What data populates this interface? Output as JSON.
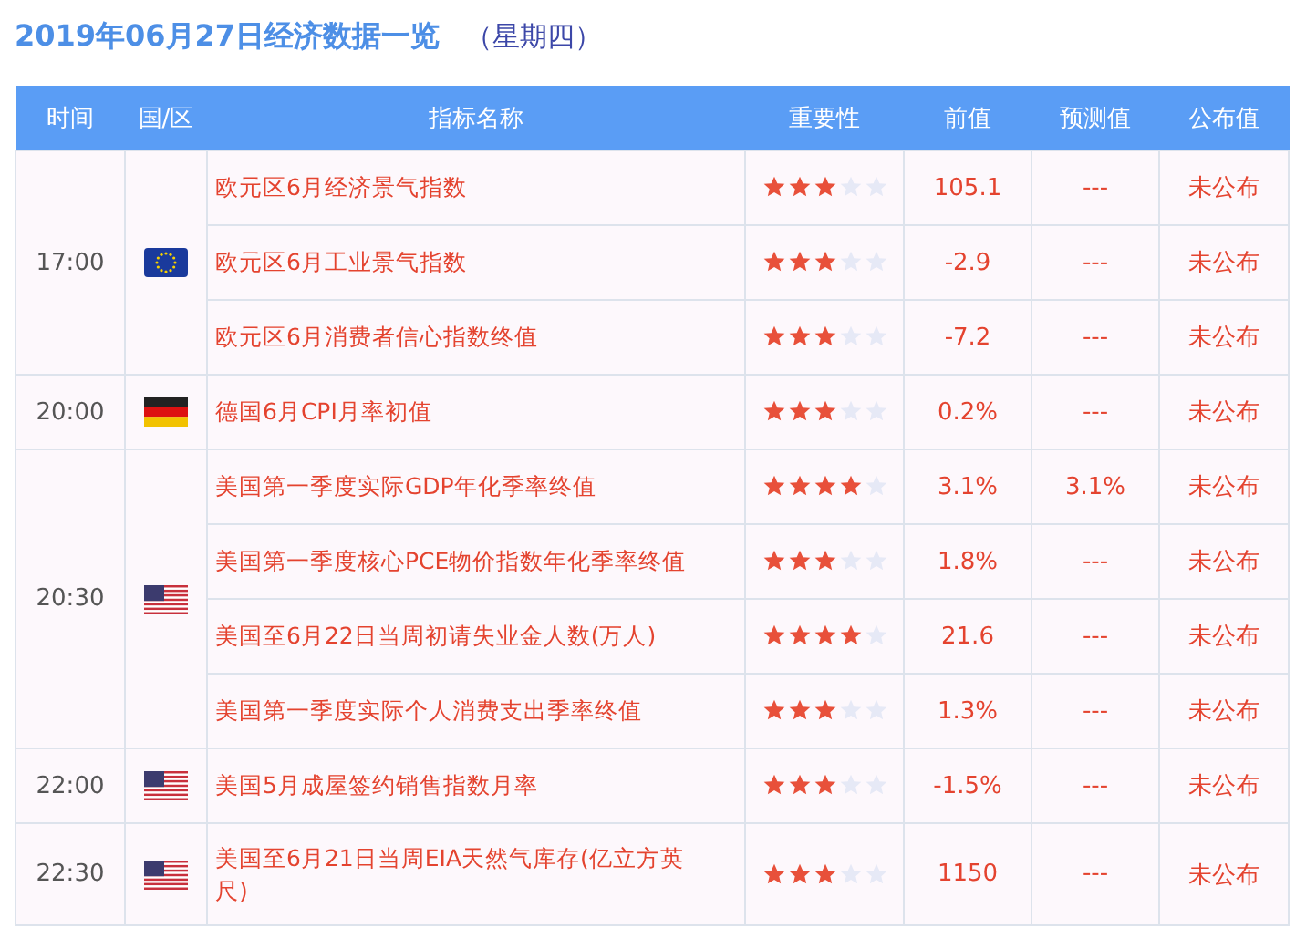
{
  "title": {
    "date": "2019年06月27日经济数据一览",
    "weekday": "（星期四）"
  },
  "columns": [
    "时间",
    "国/区",
    "指标名称",
    "重要性",
    "前值",
    "预测值",
    "公布值"
  ],
  "groups": [
    {
      "time": "17:00",
      "kind": "eu",
      "events": [
        {
          "name": "欧元区6月经济景气指数",
          "stars": 3,
          "previous": "105.1",
          "forecast": "---",
          "actual": "未公布"
        },
        {
          "name": "欧元区6月工业景气指数",
          "stars": 3,
          "previous": "-2.9",
          "forecast": "---",
          "actual": "未公布"
        },
        {
          "name": "欧元区6月消费者信心指数终值",
          "stars": 3,
          "previous": "-7.2",
          "forecast": "---",
          "actual": "未公布"
        }
      ]
    },
    {
      "time": "20:00",
      "kind": "de",
      "events": [
        {
          "name": "德国6月CPI月率初值",
          "stars": 3,
          "previous": "0.2%",
          "forecast": "---",
          "actual": "未公布"
        }
      ]
    },
    {
      "time": "20:30",
      "kind": "us",
      "events": [
        {
          "name": "美国第一季度实际GDP年化季率终值",
          "stars": 4,
          "previous": "3.1%",
          "forecast": "3.1%",
          "actual": "未公布"
        },
        {
          "name": "美国第一季度核心PCE物价指数年化季率终值",
          "stars": 3,
          "previous": "1.8%",
          "forecast": "---",
          "actual": "未公布"
        },
        {
          "name": "美国至6月22日当周初请失业金人数(万人)",
          "stars": 4,
          "previous": "21.6",
          "forecast": "---",
          "actual": "未公布"
        },
        {
          "name": "美国第一季度实际个人消费支出季率终值",
          "stars": 3,
          "previous": "1.3%",
          "forecast": "---",
          "actual": "未公布"
        }
      ]
    },
    {
      "time": "22:00",
      "kind": "us",
      "events": [
        {
          "name": "美国5月成屋签约销售指数月率",
          "stars": 3,
          "previous": "-1.5%",
          "forecast": "---",
          "actual": "未公布"
        }
      ]
    },
    {
      "time": "22:30",
      "kind": "us",
      "events": [
        {
          "name": "美国至6月21日当周EIA天然气库存(亿立方英尺)",
          "stars": 3,
          "previous": "1150",
          "forecast": "---",
          "actual": "未公布"
        }
      ]
    }
  ]
}
